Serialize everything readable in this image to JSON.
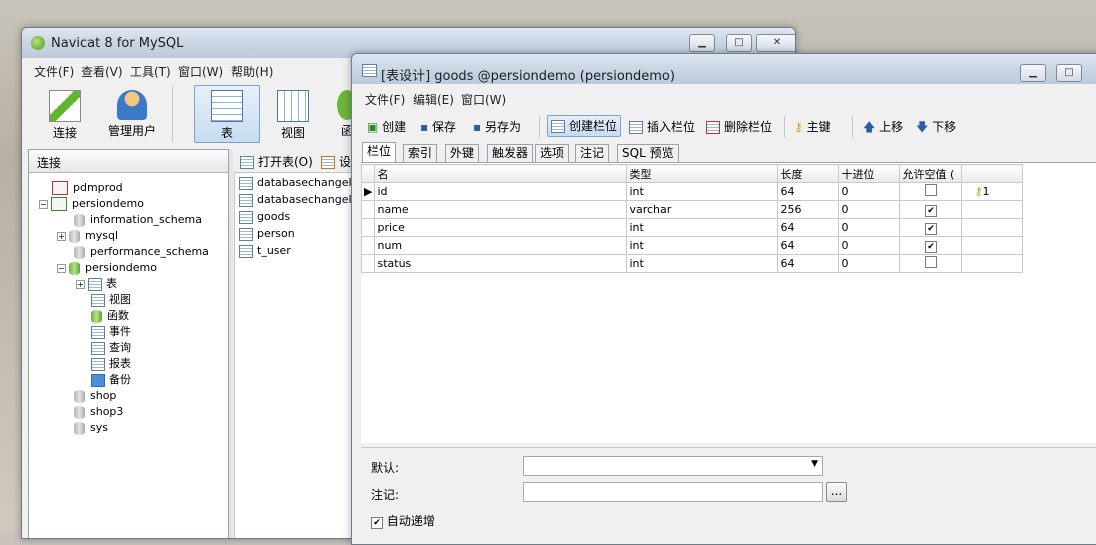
{
  "main_window": {
    "title": "Navicat 8 for MySQL",
    "menu": [
      "文件(F)",
      "查看(V)",
      "工具(T)",
      "窗口(W)",
      "帮助(H)"
    ],
    "toolbar": [
      {
        "label": "连接",
        "icon": "connect-icon"
      },
      {
        "label": "管理用户",
        "icon": "user-icon"
      },
      {
        "label": "表",
        "icon": "table-icon",
        "selected": true
      },
      {
        "label": "视图",
        "icon": "view-icon"
      },
      {
        "label": "函",
        "icon": "function-icon"
      }
    ],
    "tree_header": "连接",
    "tree": [
      {
        "label": "pdmprod",
        "type": "connection"
      },
      {
        "label": "persiondemo",
        "type": "connection",
        "expanded": true
      },
      {
        "label": "information_schema",
        "type": "database"
      },
      {
        "label": "mysql",
        "type": "database"
      },
      {
        "label": "performance_schema",
        "type": "database"
      },
      {
        "label": "persiondemo",
        "type": "database-open",
        "expanded": true
      },
      {
        "label": "表",
        "type": "node"
      },
      {
        "label": "视图",
        "type": "node"
      },
      {
        "label": "函数",
        "type": "node"
      },
      {
        "label": "事件",
        "type": "node"
      },
      {
        "label": "查询",
        "type": "node"
      },
      {
        "label": "报表",
        "type": "node"
      },
      {
        "label": "备份",
        "type": "node"
      },
      {
        "label": "shop",
        "type": "database"
      },
      {
        "label": "shop3",
        "type": "database"
      },
      {
        "label": "sys",
        "type": "database"
      }
    ],
    "object_toolbar": {
      "open": "打开表(O)",
      "design": "设"
    },
    "tables": [
      "databasechangelog",
      "databasechangelogl",
      "goods",
      "person",
      "t_user"
    ]
  },
  "design_window": {
    "title": "[表设计] goods @persiondemo (persiondemo)",
    "menu": [
      "文件(F)",
      "编辑(E)",
      "窗口(W)"
    ],
    "toolbar": [
      {
        "label": "创建"
      },
      {
        "label": "保存"
      },
      {
        "label": "另存为"
      },
      {
        "label": "创建栏位",
        "selected": true
      },
      {
        "label": "插入栏位"
      },
      {
        "label": "删除栏位"
      },
      {
        "label": "主键"
      },
      {
        "label": "上移"
      },
      {
        "label": "下移"
      }
    ],
    "tabs": [
      "栏位",
      "索引",
      "外键",
      "触发器",
      "选项",
      "注记",
      "SQL 预览"
    ],
    "columns": [
      "名",
      "类型",
      "长度",
      "十进位",
      "允许空值 ("
    ],
    "rows": [
      {
        "name": "id",
        "type": "int",
        "length": "64",
        "decimals": "0",
        "nullable": false,
        "key": "1"
      },
      {
        "name": "name",
        "type": "varchar",
        "length": "256",
        "decimals": "0",
        "nullable": true,
        "key": ""
      },
      {
        "name": "price",
        "type": "int",
        "length": "64",
        "decimals": "0",
        "nullable": true,
        "key": ""
      },
      {
        "name": "num",
        "type": "int",
        "length": "64",
        "decimals": "0",
        "nullable": true,
        "key": ""
      },
      {
        "name": "status",
        "type": "int",
        "length": "64",
        "decimals": "0",
        "nullable": false,
        "key": ""
      }
    ],
    "props": {
      "default_label": "默认:",
      "comment_label": "注记:",
      "auto_increment_label": "自动递增",
      "auto_increment": true,
      "browse": "..."
    }
  }
}
